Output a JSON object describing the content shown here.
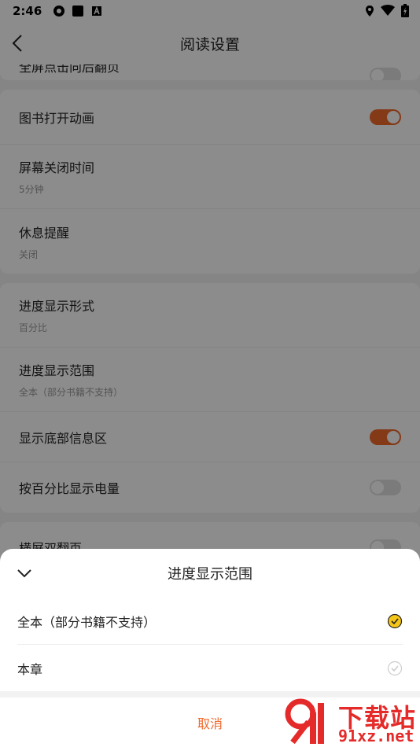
{
  "status_bar": {
    "time": "2:46"
  },
  "nav": {
    "title": "阅读设置"
  },
  "settings": {
    "partial_row": "全屏点击向后翻页",
    "group1": [
      {
        "label": "图书打开动画",
        "toggle": "on"
      },
      {
        "label": "屏幕关闭时间",
        "sub": "5分钟"
      },
      {
        "label": "休息提醒",
        "sub": "关闭"
      }
    ],
    "group2": [
      {
        "label": "进度显示形式",
        "sub": "百分比"
      },
      {
        "label": "进度显示范围",
        "sub": "全本（部分书籍不支持）"
      },
      {
        "label": "显示底部信息区",
        "toggle": "on"
      },
      {
        "label": "按百分比显示电量",
        "toggle": "off"
      }
    ],
    "group3": [
      {
        "label": "横屏双翻页",
        "toggle": "off"
      }
    ]
  },
  "sheet": {
    "title": "进度显示范围",
    "options": [
      {
        "label": "全本（部分书籍不支持）",
        "selected": true
      },
      {
        "label": "本章",
        "selected": false
      }
    ],
    "cancel": "取消"
  },
  "watermark": {
    "brand": "下载站",
    "url": "91xz.net"
  },
  "colors": {
    "accent": "#f0682a",
    "check_selected": "#f5c518",
    "watermark": "#e52a2a"
  }
}
